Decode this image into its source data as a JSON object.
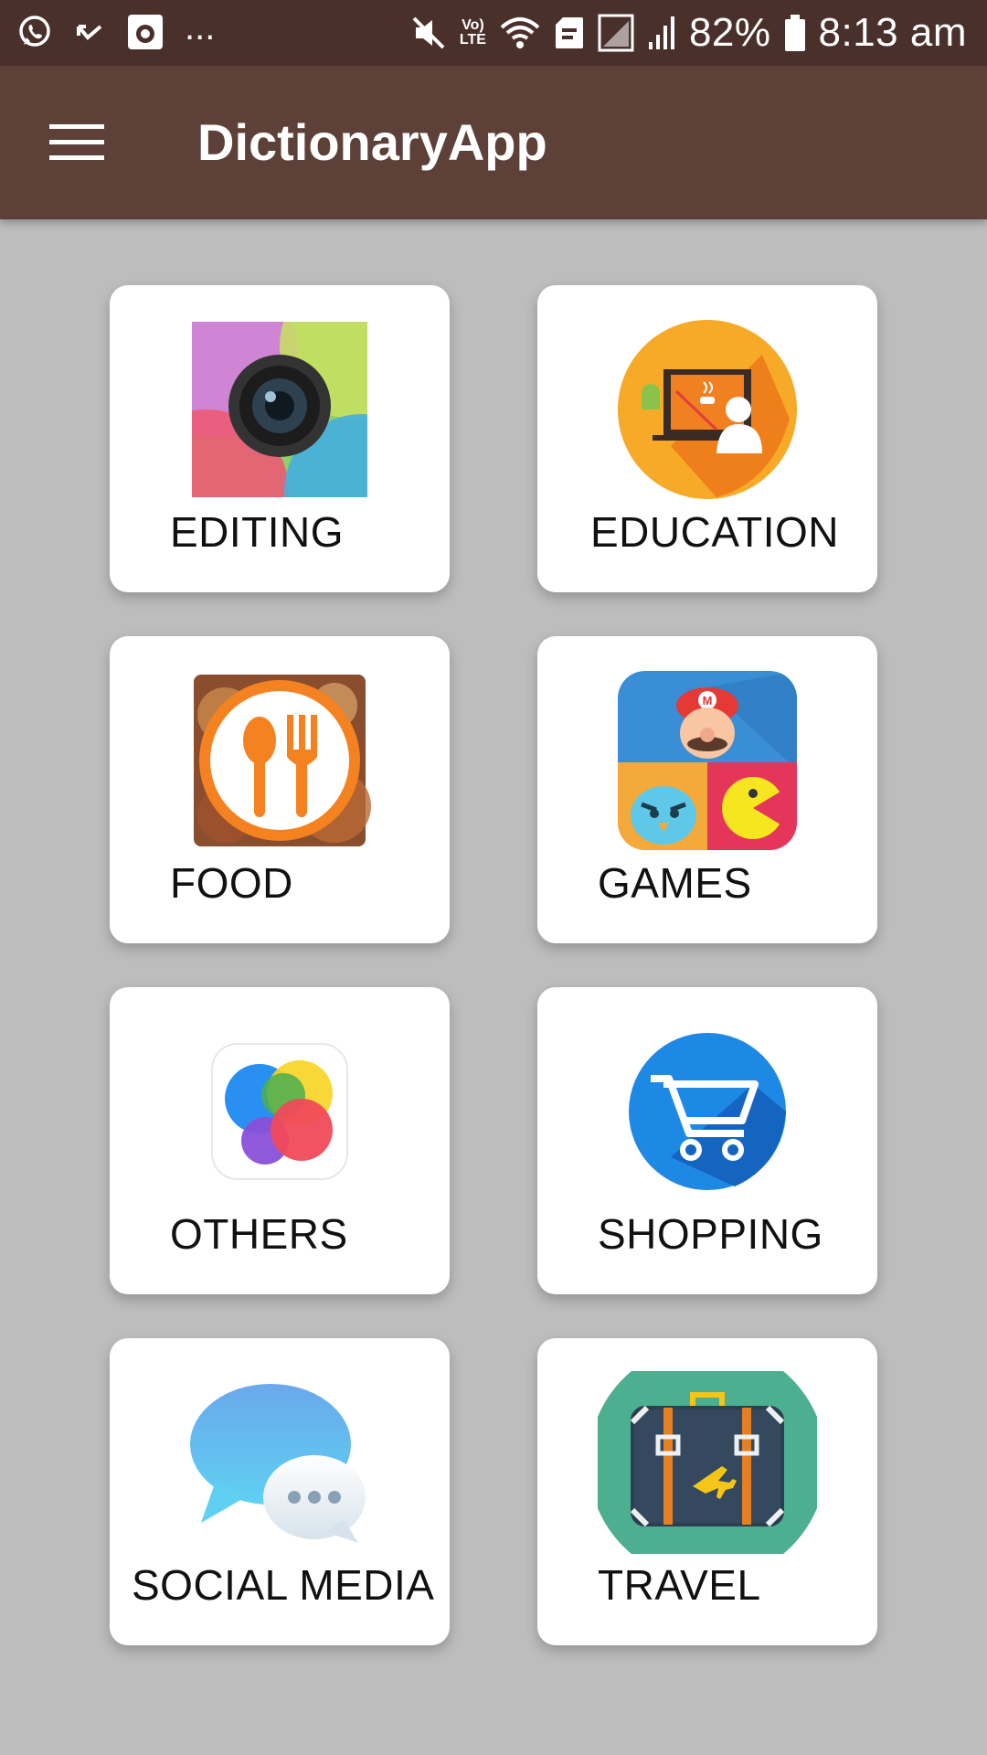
{
  "status_bar": {
    "battery": "82%",
    "time": "8:13 am",
    "dots": "...",
    "volte_top": "Vo)",
    "volte_bottom": "LTE"
  },
  "app_bar": {
    "title": "DictionaryApp",
    "menu_icon": "hamburger-menu-icon"
  },
  "categories": [
    {
      "label": "EDITING",
      "icon": "camera-lens-icon"
    },
    {
      "label": "EDUCATION",
      "icon": "teacher-board-icon"
    },
    {
      "label": "FOOD",
      "icon": "spoon-fork-icon"
    },
    {
      "label": "GAMES",
      "icon": "game-characters-icon"
    },
    {
      "label": "OTHERS",
      "icon": "colored-circles-icon"
    },
    {
      "label": "SHOPPING",
      "icon": "shopping-cart-icon"
    },
    {
      "label": "SOCIAL MEDIA",
      "icon": "chat-bubbles-icon"
    },
    {
      "label": "TRAVEL",
      "icon": "suitcase-icon"
    }
  ],
  "colors": {
    "status_bar": "#4a302a",
    "app_bar": "#5d4037",
    "background": "#bdbdbd",
    "card": "#ffffff"
  }
}
